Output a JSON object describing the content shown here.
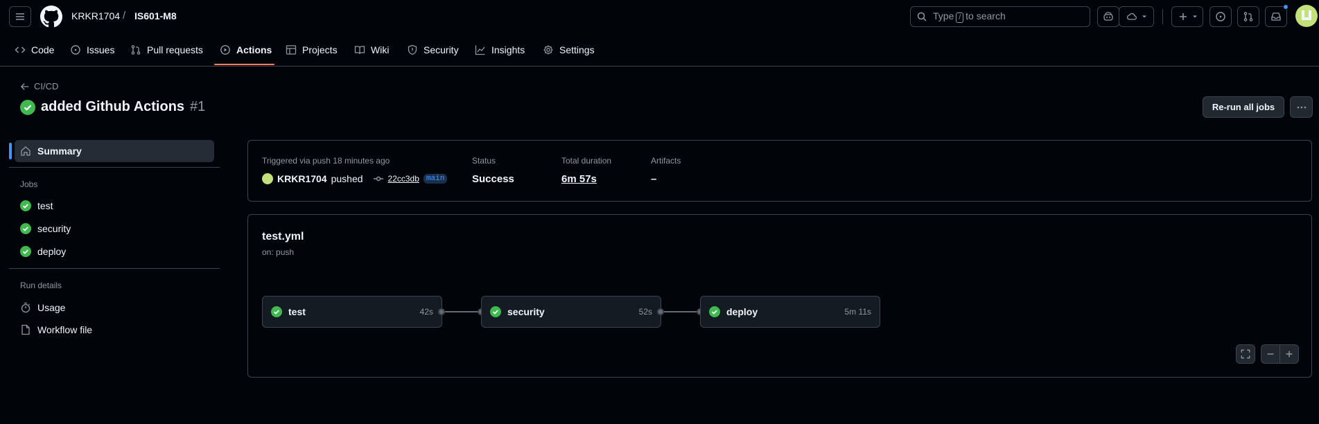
{
  "header": {
    "repo_owner": "KRKR1704",
    "repo_separator": "/",
    "repo_name": "IS601-M8",
    "search": {
      "prefix": "Type",
      "key": "/",
      "suffix": "to search"
    },
    "icons": [
      "menu-icon",
      "github-logo-icon",
      "search-icon",
      "copilot-icon",
      "cloud-icon",
      "plus-icon",
      "issues-icon",
      "pull-request-icon",
      "inbox-icon",
      "avatar"
    ]
  },
  "tabs": [
    {
      "label": "Code",
      "icon": "code-icon"
    },
    {
      "label": "Issues",
      "icon": "issue-icon"
    },
    {
      "label": "Pull requests",
      "icon": "pull-request-icon"
    },
    {
      "label": "Actions",
      "icon": "play-icon",
      "active": true
    },
    {
      "label": "Projects",
      "icon": "table-icon"
    },
    {
      "label": "Wiki",
      "icon": "book-icon"
    },
    {
      "label": "Security",
      "icon": "shield-icon"
    },
    {
      "label": "Insights",
      "icon": "graph-icon"
    },
    {
      "label": "Settings",
      "icon": "gear-icon"
    }
  ],
  "run": {
    "back_label": "CI/CD",
    "title": "added Github Actions",
    "number": "#1",
    "rerun_label": "Re-run all jobs"
  },
  "sidebar": {
    "summary_label": "Summary",
    "jobs_heading": "Jobs",
    "jobs": [
      {
        "label": "test"
      },
      {
        "label": "security"
      },
      {
        "label": "deploy"
      }
    ],
    "run_details_heading": "Run details",
    "usage_label": "Usage",
    "workflow_file_label": "Workflow file"
  },
  "summary": {
    "trigger": "Triggered via push 18 minutes ago",
    "actor": "KRKR1704",
    "action": "pushed",
    "sha": "22cc3db",
    "branch": "main",
    "status_label": "Status",
    "status_value": "Success",
    "duration_label": "Total duration",
    "duration_value": "6m 57s",
    "artifacts_label": "Artifacts",
    "artifacts_value": "–"
  },
  "workflow": {
    "file": "test.yml",
    "trigger": "on: push",
    "jobs": [
      {
        "name": "test",
        "duration": "42s"
      },
      {
        "name": "security",
        "duration": "52s"
      },
      {
        "name": "deploy",
        "duration": "5m 11s"
      }
    ]
  },
  "colors": {
    "background": "#010409",
    "border": "#3d444d",
    "success": "#3fb950",
    "accent": "#4493f8",
    "active_tab": "#f78166"
  }
}
